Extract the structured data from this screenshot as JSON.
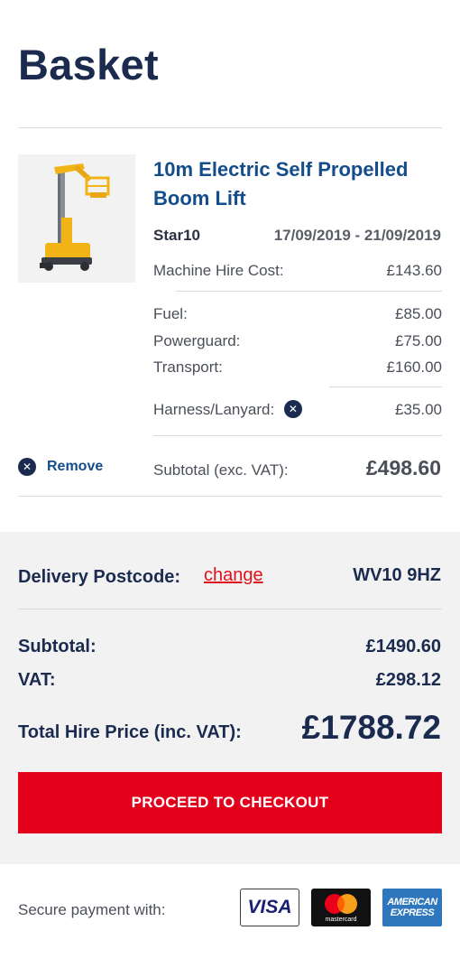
{
  "page": {
    "title": "Basket"
  },
  "item": {
    "name": "10m Electric Self Propelled Boom Lift",
    "code": "Star10",
    "dates": "17/09/2019 - 21/09/2019",
    "machine_hire_label": "Machine Hire Cost:",
    "machine_hire_value": "£143.60",
    "fuel_label": "Fuel:",
    "fuel_value": "£85.00",
    "powerguard_label": "Powerguard:",
    "powerguard_value": "£75.00",
    "transport_label": "Transport:",
    "transport_value": "£160.00",
    "harness_label": "Harness/Lanyard:",
    "harness_value": "£35.00",
    "remove_label": "Remove",
    "subtotal_label": "Subtotal (exc. VAT):",
    "subtotal_value": "£498.60",
    "image_icon": "boom-lift-image",
    "remove_icon": "close-circle-icon"
  },
  "summary": {
    "delivery_label": "Delivery Postcode:",
    "change_label": "change",
    "postcode": "WV10 9HZ",
    "subtotal_label": "Subtotal:",
    "subtotal_value": "£1490.60",
    "vat_label": "VAT:",
    "vat_value": "£298.12",
    "total_label": "Total Hire Price (inc. VAT):",
    "total_value": "£1788.72",
    "checkout_label": "PROCEED TO CHECKOUT"
  },
  "payment": {
    "secure_label": "Secure payment with:",
    "visa_label": "VISA",
    "mastercard_label": "mastercard",
    "amex_line1": "AMERICAN",
    "amex_line2": "EXPRESS"
  },
  "colors": {
    "navy": "#1b2b4f",
    "link_blue": "#144d8a",
    "accent_red": "#e3001b",
    "summary_bg": "#f2f2f2"
  }
}
